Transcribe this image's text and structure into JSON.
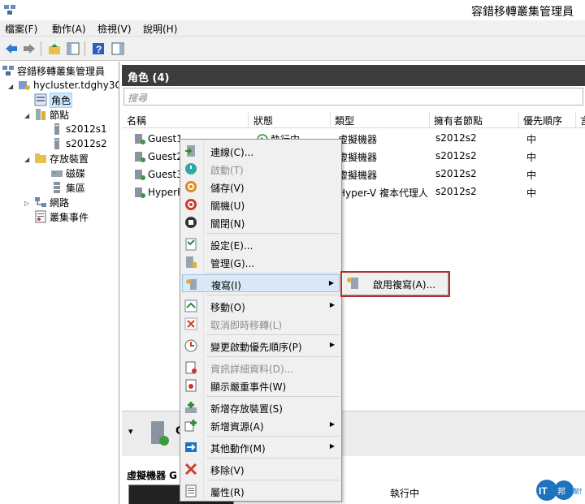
{
  "window": {
    "title": "容錯移轉叢集管理員"
  },
  "menubar": [
    "檔案(F)",
    "動作(A)",
    "檢視(V)",
    "說明(H)"
  ],
  "tree": {
    "root": "容錯移轉叢集管理員",
    "cluster": "hycluster.tdghy3C",
    "roles": "角色",
    "nodes": "節點",
    "node1": "s2012s1",
    "node2": "s2012s2",
    "storage": "存放裝置",
    "disks": "磁碟",
    "pools": "集區",
    "network": "網路",
    "events": "叢集事件"
  },
  "main": {
    "header": "角色 (4)",
    "search_placeholder": "搜尋",
    "columns": [
      "名稱",
      "狀態",
      "類型",
      "擁有者節點",
      "優先順序",
      "言"
    ],
    "rows": [
      {
        "name": "Guest1",
        "status": "執行中",
        "type": "虛擬機器",
        "owner": "s2012s2",
        "priority": "中"
      },
      {
        "name": "Guest2",
        "status": "",
        "type": "虛擬機器",
        "owner": "s2012s2",
        "priority": "中"
      },
      {
        "name": "Guest3",
        "status": "",
        "type": "虛擬機器",
        "owner": "s2012s2",
        "priority": "中"
      },
      {
        "name": "HyperRe",
        "status": "",
        "type": "Hyper-V 複本代理人",
        "owner": "s2012s2",
        "priority": "中"
      }
    ],
    "detail_title": "虛擬機器 G",
    "detail_status": "執行中",
    "detail_header_letter": "G"
  },
  "context_menu": {
    "items": [
      {
        "label": "連線(C)...",
        "disabled": false
      },
      {
        "label": "啟動(T)",
        "disabled": true
      },
      {
        "label": "儲存(V)",
        "disabled": false
      },
      {
        "label": "關機(U)",
        "disabled": false
      },
      {
        "label": "關閉(N)",
        "disabled": false
      },
      {
        "label": "設定(E)...",
        "disabled": false
      },
      {
        "label": "管理(G)...",
        "disabled": false
      },
      {
        "label": "複寫(I)",
        "disabled": false
      },
      {
        "label": "移動(O)",
        "disabled": false
      },
      {
        "label": "取消即時移轉(L)",
        "disabled": true
      },
      {
        "label": "變更啟動優先順序(P)",
        "disabled": false
      },
      {
        "label": "資訊詳細資料(D)...",
        "disabled": true
      },
      {
        "label": "顯示嚴重事件(W)",
        "disabled": false
      },
      {
        "label": "新增存放裝置(S)",
        "disabled": false
      },
      {
        "label": "新增資源(A)",
        "disabled": false
      },
      {
        "label": "其他動作(M)",
        "disabled": false
      },
      {
        "label": "移除(V)",
        "disabled": false
      },
      {
        "label": "屬性(R)",
        "disabled": false
      }
    ],
    "submenu_label": "啟用複寫(A)..."
  },
  "watermark": {
    "text": "IT 邦 幫忙",
    "sub": "幫忙"
  },
  "colors": {
    "header_bg": "#3c3c3c",
    "highlight_border": "#b03030",
    "accent": "#1e73be"
  }
}
